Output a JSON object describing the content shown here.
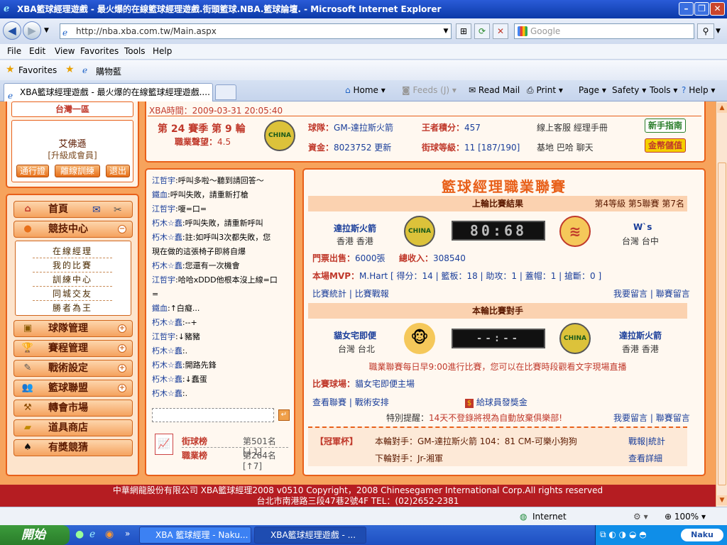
{
  "window": {
    "title": "XBA籃球經理遊戲 - 最火爆的在線籃球經理遊戲.街頭籃球.NBA.籃球論壇. - Microsoft Internet Explorer"
  },
  "browser": {
    "url": "http://nba.xba.com.tw/Main.aspx",
    "search_placeholder": "Google",
    "menu": [
      "File",
      "Edit",
      "View",
      "Favorites",
      "Tools",
      "Help"
    ],
    "favorites_label": "Favorites",
    "favorites_item": "購物藍",
    "tab_title": "XBA籃球經理遊戲 - 最火爆的在線籃球經理遊戲....",
    "commands": {
      "home": "Home",
      "feeds": "Feeds (J)",
      "read_mail": "Read Mail",
      "print": "Print",
      "page": "Page",
      "safety": "Safety",
      "tools": "Tools",
      "help": "Help"
    }
  },
  "left": {
    "region": "台灣一區",
    "user_name": "艾佛遜",
    "user_level": "[升級成會員]",
    "buttons": [
      "通行證",
      "離線訓練",
      "退出"
    ],
    "home_label": "首頁",
    "menu": {
      "competition": "競技中心",
      "team": "球隊管理",
      "schedule": "賽程管理",
      "tactics": "戰術設定",
      "league": "籃球聯盟",
      "transfer": "轉會市場",
      "shop": "道具商店",
      "lottery": "有獎競猜"
    },
    "submenu": [
      "在線經理",
      "我的比賽",
      "訓練中心",
      "同城交友",
      "勝者為王"
    ]
  },
  "header": {
    "time_label": "XBA時間：",
    "time": "2009-03-31 20:05:40",
    "season": "第 24 賽季 第 9 輪",
    "pro_label": "職業聲望：",
    "pro_value": "4.5",
    "team_label": "球隊：",
    "team_value": "GM-達拉斯火箭",
    "king_label": "王者積分：",
    "king_value": "457",
    "cash_label": "資金：",
    "cash_value": "8023752",
    "refresh": "更新",
    "street_label": "街球等級：",
    "street_value": "11 [187/190]",
    "links1": "線上客服 經理手冊",
    "links2": "基地 巴哈 聊天",
    "newbie_btn": "新手指南",
    "gold_btn": "金幣儲值"
  },
  "chat": [
    {
      "name": "江哲宇",
      "msg": ":呼叫多啦～聽到請回答～"
    },
    {
      "name": "鐵血",
      "msg": ":呼叫失敗，請重新打槍"
    },
    {
      "name": "江哲宇",
      "msg": ":嗄=口="
    },
    {
      "name": "朽木☆蠢",
      "msg": ":呼叫失敗，請重新呼叫"
    },
    {
      "name": "朽木☆蠢",
      "msg": ":註:如呼叫3次都失敗，您"
    },
    {
      "name": "",
      "msg": "現在做的這張椅子即將自爆"
    },
    {
      "name": "朽木☆蠢",
      "msg": ":您還有一次機會"
    },
    {
      "name": "江哲宇",
      "msg": ":哈哈xDDD他根本沒上線=口"
    },
    {
      "name": "",
      "msg": "="
    },
    {
      "name": "鐵血",
      "msg": ":↑白癡..."
    },
    {
      "name": "朽木☆蠢",
      "msg": ":--+"
    },
    {
      "name": "江哲宇",
      "msg": ":↓豬豬"
    },
    {
      "name": "朽木☆蠢",
      "msg": ":."
    },
    {
      "name": "朽木☆蠢",
      "msg": ":開路先鋒"
    },
    {
      "name": "朽木☆蠢",
      "msg": ":↓蠢蛋"
    },
    {
      "name": "朽木☆蠢",
      "msg": ":."
    }
  ],
  "ranks": {
    "street_label": "街球榜",
    "street_value": "第501名[↓1]",
    "pro_label": "職業榜",
    "pro_value": "第264名[↑7]"
  },
  "main": {
    "title": "籃球經理職業聯賽",
    "last_result_title": "上輪比賽結果",
    "level_info": "第4等級 第5聯賽 第7名",
    "home_team": "達拉斯火箭",
    "home_city": "香港 香港",
    "score": "80:68",
    "away_team": "W`s",
    "away_city": "台灣 台中",
    "tickets_label": "門票出售：",
    "tickets_value": "6000張",
    "income_label": "總收入：",
    "income_value": "308540",
    "mvp_label": "本場MVP：",
    "mvp_value": "M.Hart [ 得分：14 | 籃板：18 | 助攻：1 | 蓋帽：1 | 搶斷：0 ]",
    "stats_link": "比賽統計",
    "report_link": "比賽戰報",
    "msg_link": "我要留言",
    "league_msg_link": "聯賽留言",
    "opponent_title": "本輪比賽對手",
    "opp_home": "貓女宅即便",
    "opp_home_city": "台灣 台北",
    "opp_score": "--:--",
    "opp_away": "達拉斯火箭",
    "opp_away_city": "香港 香港",
    "schedule_note": "職業聯賽每日早9:00進行比賽，您可以在比賽時段觀看文字現場直播",
    "venue_label": "比賽球場：",
    "venue_value": "貓女宅即便主場",
    "view_league": "查看聯賽",
    "tactics": "戰術安排",
    "bonus": "給球員發獎金",
    "reminder_label": "特別提醒：",
    "reminder": "14天不登錄將視為自動放棄俱樂部!",
    "cup_label": "【冠軍杯】",
    "cup_this_label": "本輪對手：",
    "cup_this": "GM-達拉斯火箭 104：81 CM-可樂小狗狗",
    "cup_report": "戰報|統計",
    "cup_next_label": "下輪對手：",
    "cup_next": "Jr-湘軍",
    "cup_detail": "查看詳細"
  },
  "footer": {
    "line1": "中華網龍股份有限公司 XBA籃球經理2008 v0510 Copyright，2008 Chinesegamer International Corp.All rights reserved",
    "line2": "台北市南港路三段47巷2號4F TEL：(02)2652-2381"
  },
  "status": {
    "zone": "Internet",
    "zoom": "100%"
  },
  "taskbar": {
    "start": "開始",
    "tasks": [
      "XBA 籃球經理 - Naku...",
      "XBA籃球經理遊戲 - ..."
    ],
    "tray_label": "Naku"
  },
  "colors": {
    "brand_orange": "#e8601a",
    "footer_red": "#b51d22",
    "link_blue": "#1a3e9a",
    "label_red": "#c0392b"
  }
}
